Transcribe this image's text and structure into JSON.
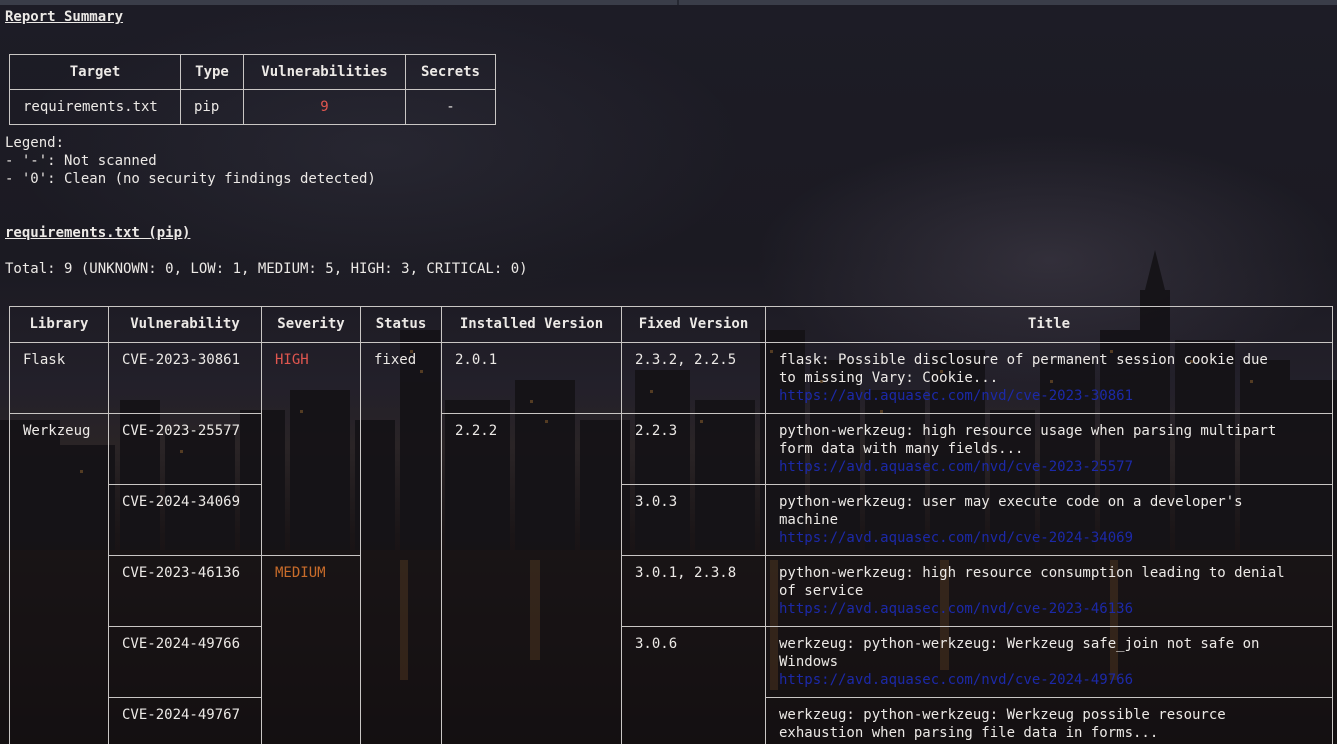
{
  "report": {
    "heading": "Report Summary",
    "summary_table": {
      "headers": [
        "Target",
        "Type",
        "Vulnerabilities",
        "Secrets"
      ],
      "row": {
        "target": "requirements.txt",
        "type": "pip",
        "vulnerabilities": "9",
        "secrets": "-"
      }
    },
    "legend": {
      "title": "Legend:",
      "lines": [
        "- '-': Not scanned",
        "- '0': Clean (no security findings detected)"
      ]
    }
  },
  "section": {
    "heading": "requirements.txt (pip)",
    "total": "Total: 9 (UNKNOWN: 0, LOW: 1, MEDIUM: 5, HIGH: 3, CRITICAL: 0)"
  },
  "vuln_table": {
    "headers": [
      "Library",
      "Vulnerability",
      "Severity",
      "Status",
      "Installed Version",
      "Fixed Version",
      "Title"
    ],
    "rows": [
      {
        "library": "Flask",
        "vulnerability": "CVE-2023-30861",
        "severity": "HIGH",
        "status": "fixed",
        "installed": "2.0.1",
        "fixed": "2.3.2, 2.2.5",
        "title": "flask: Possible disclosure of permanent session cookie due\nto missing Vary: Cookie...",
        "link": "https://avd.aquasec.com/nvd/cve-2023-30861"
      },
      {
        "library": "Werkzeug",
        "vulnerability": "CVE-2023-25577",
        "severity": "",
        "status": "",
        "installed": "2.2.2",
        "fixed": "2.2.3",
        "title": "python-werkzeug: high resource usage when parsing multipart\nform data with many fields...",
        "link": "https://avd.aquasec.com/nvd/cve-2023-25577"
      },
      {
        "library": "",
        "vulnerability": "CVE-2024-34069",
        "severity": "",
        "status": "",
        "installed": "",
        "fixed": "3.0.3",
        "title": "python-werkzeug: user may execute code on a developer's\nmachine",
        "link": "https://avd.aquasec.com/nvd/cve-2024-34069"
      },
      {
        "library": "",
        "vulnerability": "CVE-2023-46136",
        "severity": "MEDIUM",
        "status": "",
        "installed": "",
        "fixed": "3.0.1, 2.3.8",
        "title": "python-werkzeug: high resource consumption leading to denial\nof service",
        "link": "https://avd.aquasec.com/nvd/cve-2023-46136"
      },
      {
        "library": "",
        "vulnerability": "CVE-2024-49766",
        "severity": "",
        "status": "",
        "installed": "",
        "fixed": "3.0.6",
        "title": "werkzeug: python-werkzeug: Werkzeug safe_join not safe on\nWindows",
        "link": "https://avd.aquasec.com/nvd/cve-2024-49766"
      },
      {
        "library": "",
        "vulnerability": "CVE-2024-49767",
        "severity": "",
        "status": "",
        "installed": "",
        "fixed": "",
        "title": "werkzeug: python-werkzeug: Werkzeug possible resource\nexhaustion when parsing file data in forms...",
        "link": ""
      }
    ]
  },
  "colors": {
    "high": "#e0564f",
    "medium": "#c96c2a",
    "link": "#1c29a8",
    "text": "#ece9e6"
  }
}
